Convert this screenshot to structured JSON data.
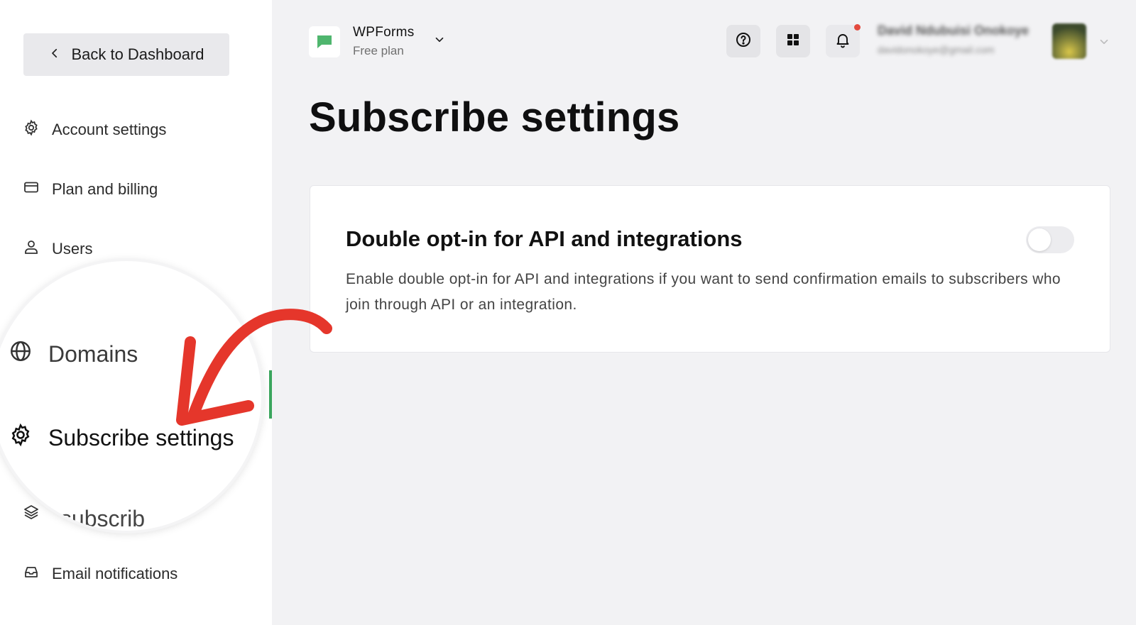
{
  "sidebar": {
    "back_label": "Back to Dashboard",
    "items": [
      {
        "label": "Account settings",
        "icon": "gear-icon"
      },
      {
        "label": "Plan and billing",
        "icon": "credit-card-icon"
      },
      {
        "label": "Users",
        "icon": "user-icon"
      },
      {
        "label": "Domains",
        "icon": "globe-icon"
      },
      {
        "label": "Subscribe settings",
        "icon": "gear-icon",
        "active": true
      },
      {
        "label": "Unsubscribe",
        "icon": "layers-icon",
        "visible_text": "Unsubscrib"
      },
      {
        "label": "Email notifications",
        "icon": "inbox-icon"
      }
    ]
  },
  "header": {
    "brand_name": "WPForms",
    "brand_plan": "Free plan",
    "user_name": "David Ndubuisi Onokoye",
    "user_email": "davidonokoye@gmail.com"
  },
  "main": {
    "title": "Subscribe settings",
    "card": {
      "title": "Double opt-in for API and integrations",
      "description": "Enable double opt-in for API and integrations if you want to send confirmation emails to subscribers who join through API or an integration.",
      "toggle_on": false
    }
  },
  "colors": {
    "accent_green": "#3aa55d",
    "annotation_red": "#e5362b",
    "notification_dot": "#e34a3e"
  }
}
